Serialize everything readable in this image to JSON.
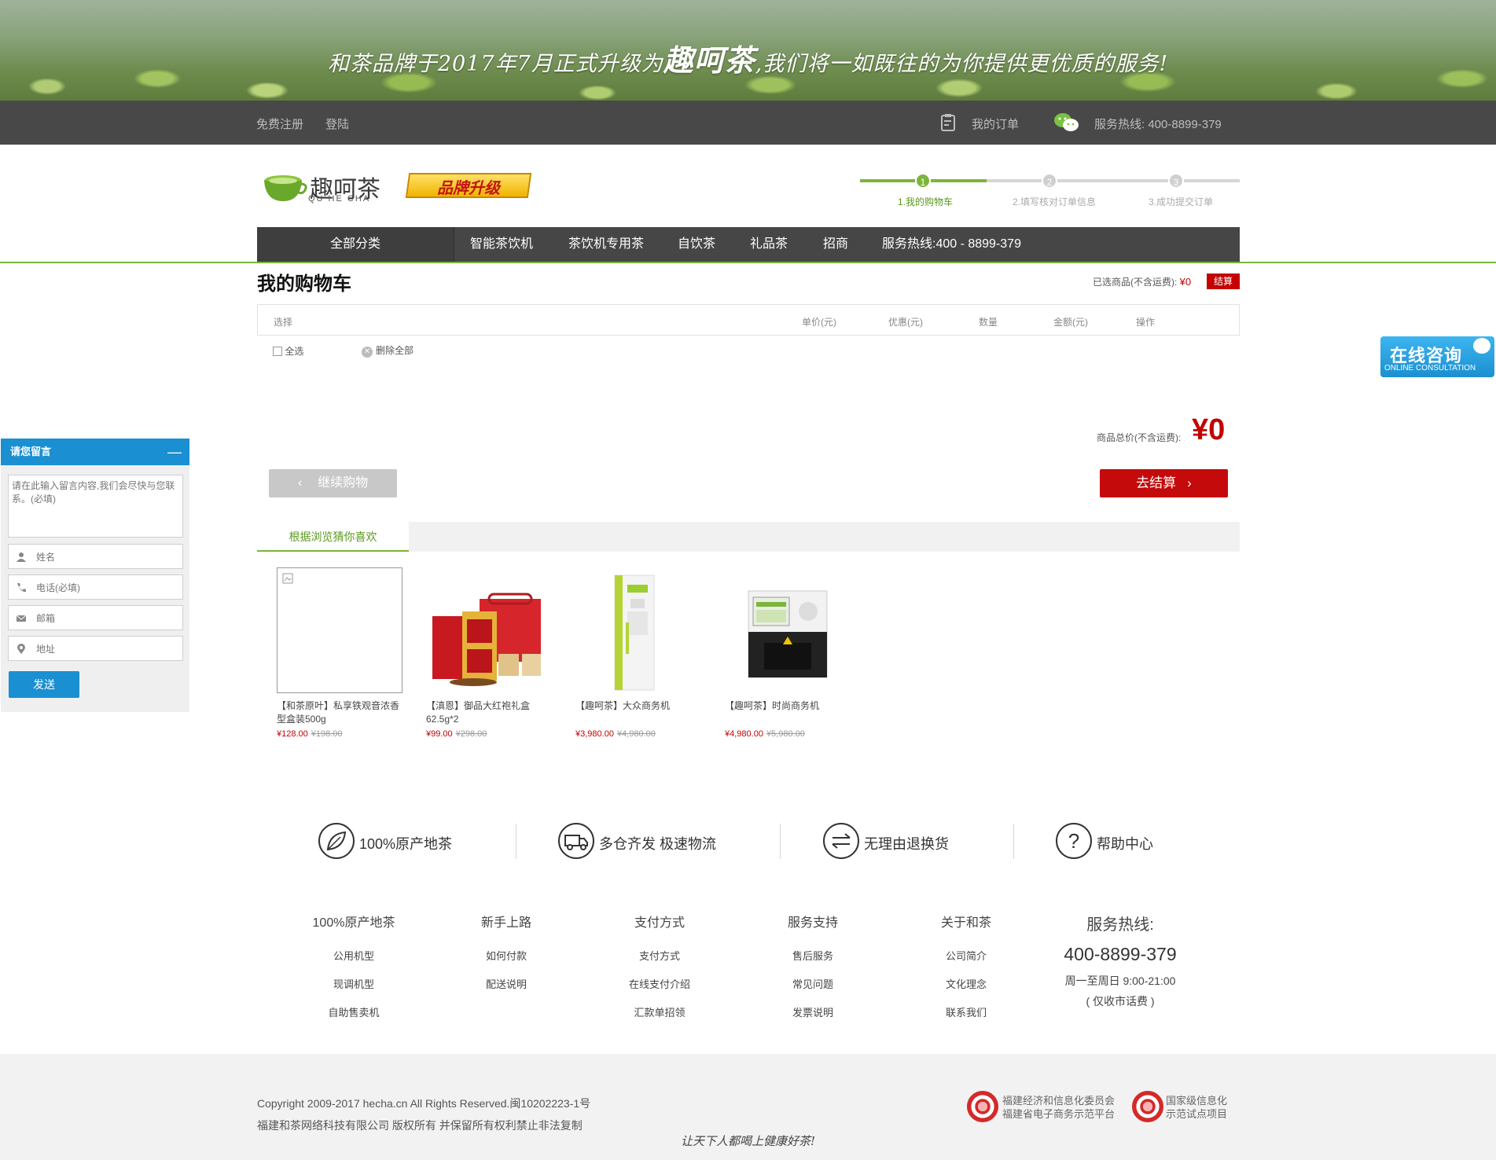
{
  "banner": {
    "slogan_pre": "和茶品牌于2017年7月正式升级为",
    "slogan_brand": "趣呵茶",
    "slogan_post": ",我们将一如既往的为你提供更优质的服务!"
  },
  "topbar": {
    "register": "免费注册",
    "login": "登陆",
    "my_orders": "我的订单",
    "hotline": "服务热线: 400-8899-379"
  },
  "logo": {
    "name": "趣呵茶",
    "pinyin": "QU HE CHA",
    "badge": "品牌升级"
  },
  "steps": [
    {
      "num": "1",
      "label": "1.我的购物车",
      "active": true
    },
    {
      "num": "2",
      "label": "2.填写核对订单信息",
      "active": false
    },
    {
      "num": "3",
      "label": "3.成功提交订单",
      "active": false
    }
  ],
  "nav": {
    "all": "全部分类",
    "items": [
      "智能茶饮机",
      "茶饮机专用茶",
      "自饮茶",
      "礼品茶",
      "招商",
      "服务热线:400 - 8899-379"
    ]
  },
  "cart": {
    "title": "我的购物车",
    "selected_label": "已选商品(不含运费):",
    "selected_price": "¥0",
    "checkout_small": "结算",
    "columns": [
      "选择",
      "单价(元)",
      "优惠(元)",
      "数量",
      "金额(元)",
      "操作"
    ],
    "select_all": "全选",
    "delete_all": "删除全部",
    "total_label": "商品总价(不含运费):",
    "total_value": "¥0",
    "continue": "继续购物",
    "go_checkout": "去结算"
  },
  "recommend": {
    "tab": "根据浏览猜你喜欢",
    "products": [
      {
        "name": "【和茶原叶】私享铁观音浓香型盒装500g",
        "price": "¥128.00",
        "old_price": "¥198.00"
      },
      {
        "name": "【滇恩】御品大红袍礼盒62.5g*2",
        "price": "¥99.00",
        "old_price": "¥298.00"
      },
      {
        "name": "【趣呵茶】大众商务机",
        "price": "¥3,980.00",
        "old_price": "¥4,980.00"
      },
      {
        "name": "【趣呵茶】时尚商务机",
        "price": "¥4,980.00",
        "old_price": "¥5,980.00"
      }
    ]
  },
  "features": [
    "100%原产地茶",
    "多仓齐发 极速物流",
    "无理由退换货",
    "帮助中心"
  ],
  "footer_cols": [
    {
      "title": "100%原产地茶",
      "items": [
        "公用机型",
        "现调机型",
        "自助售卖机"
      ]
    },
    {
      "title": "新手上路",
      "items": [
        "如何付款",
        "配送说明"
      ]
    },
    {
      "title": "支付方式",
      "items": [
        "支付方式",
        "在线支付介绍",
        "汇款单招领"
      ]
    },
    {
      "title": "服务支持",
      "items": [
        "售后服务",
        "常见问题",
        "发票说明"
      ]
    },
    {
      "title": "关于和茶",
      "items": [
        "公司简介",
        "文化理念",
        "联系我们"
      ]
    }
  ],
  "hotline": {
    "title": "服务热线:",
    "number": "400-8899-379",
    "hours": "周一至周日 9:00-21:00",
    "note": "( 仅收市话费 )"
  },
  "copyright": {
    "line1": "Copyright 2009-2017 hecha.cn All Rights Reserved.闽10202223-1号",
    "line2": "福建和茶网络科技有限公司 版权所有 并保留所有权利禁止非法复制"
  },
  "seals": [
    {
      "line1": "福建经济和信息化委员会",
      "line2": "福建省电子商务示范平台"
    },
    {
      "line1": "国家级信息化",
      "line2": "示范试点项目"
    }
  ],
  "tagline": "让天下人都喝上健康好茶!",
  "message": {
    "title": "请您留言",
    "minimize": "—",
    "content_placeholder": "请在此输入留言内容,我们会尽快与您联系。(必填)",
    "name_placeholder": "姓名",
    "phone_placeholder": "电话(必填)",
    "email_placeholder": "邮箱",
    "address_placeholder": "地址",
    "send": "发送"
  },
  "online": {
    "title": "在线咨询",
    "subtitle": "ONLINE CONSULTATION"
  },
  "colors": {
    "green": "#7cb53b",
    "red": "#c40000",
    "nav": "#464646",
    "blue": "#1a8fd1"
  }
}
